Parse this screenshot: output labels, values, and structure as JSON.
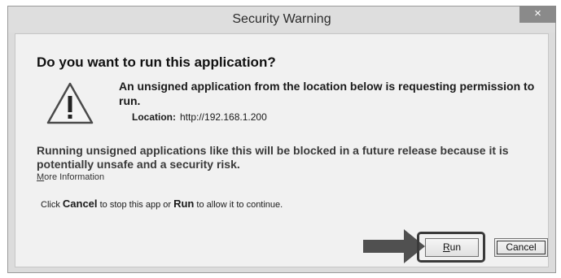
{
  "window": {
    "title": "Security Warning",
    "close_glyph": "×"
  },
  "dialog": {
    "heading": "Do you want to run this application?",
    "icon": "warning-triangle-icon",
    "description": "An unsigned application from the location below is requesting permission to run.",
    "location_label": "Location:",
    "location_value": "http://192.168.1.200",
    "notice": "Running unsigned applications like this will be blocked in a future release because it is potentially unsafe and a security risk.",
    "more_info_first": "M",
    "more_info_rest": "ore Information",
    "instruction": {
      "part1": "Click ",
      "cancel_word": "Cancel",
      "part2": " to stop this app or ",
      "run_word": "Run",
      "part3": " to allow it to continue."
    }
  },
  "buttons": {
    "run_first": "R",
    "run_rest": "un",
    "cancel": "Cancel"
  },
  "colors": {
    "titlebar": "#dedede",
    "content_bg": "#f1f1f1",
    "highlight": "#3a3a3a",
    "arrow": "#505050"
  }
}
